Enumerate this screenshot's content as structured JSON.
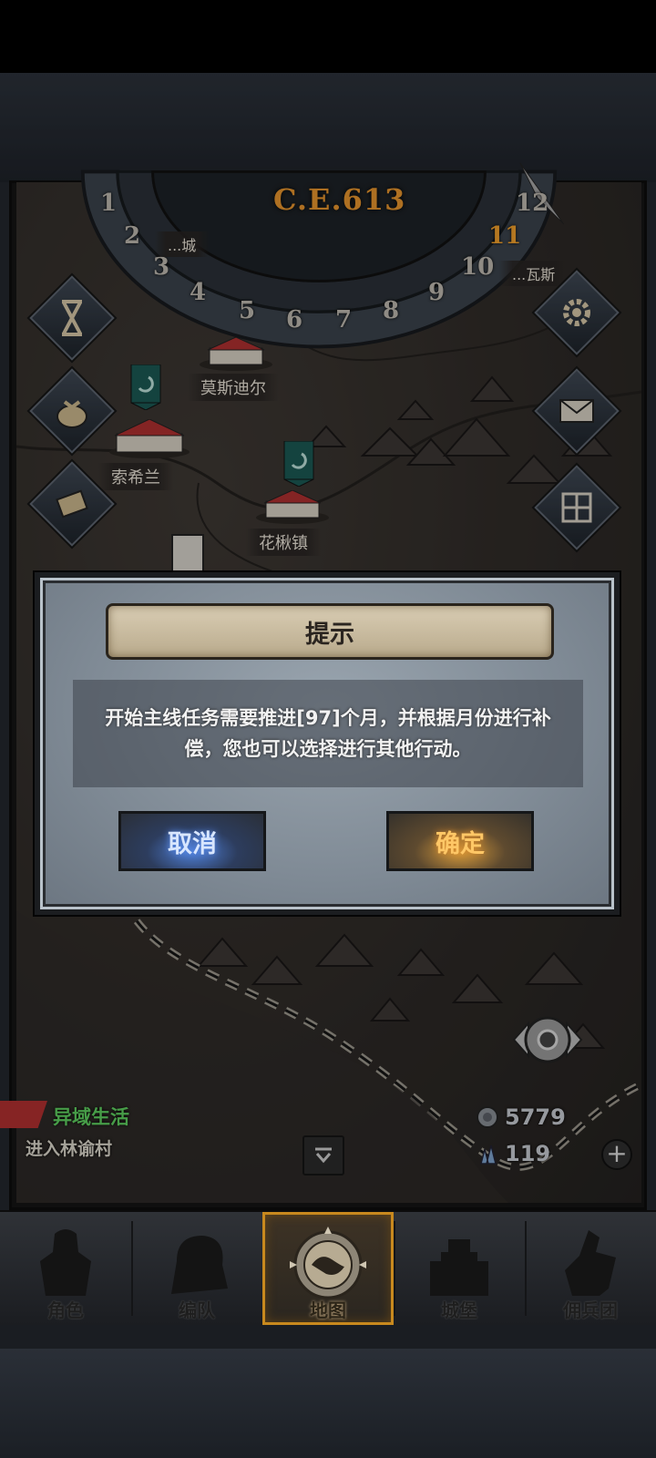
{
  "calendar": {
    "year": "C.E.613",
    "months": [
      "1",
      "2",
      "3",
      "4",
      "5",
      "6",
      "7",
      "8",
      "9",
      "10",
      "11",
      "12"
    ],
    "current_month": "11"
  },
  "map": {
    "towns": [
      {
        "label": "莫斯迪尔"
      },
      {
        "label": "索希兰"
      },
      {
        "label": "花楸镇"
      }
    ],
    "partial_labels": [
      "...城",
      "...瓦斯"
    ]
  },
  "side_buttons": [
    {
      "icon": "hourglass-icon"
    },
    {
      "icon": "money-bag-icon"
    },
    {
      "icon": "scroll-icon"
    },
    {
      "icon": "gear-icon"
    },
    {
      "icon": "mail-icon"
    },
    {
      "icon": "window-icon"
    }
  ],
  "quest": {
    "title": "异域生活",
    "subtitle": "进入林谕村"
  },
  "resources": {
    "silver": "5779",
    "crystal": "119"
  },
  "dialog": {
    "title": "提示",
    "message": "开始主线任务需要推进[97]个月，并根据月份进行补偿，您也可以选择进行其他行动。",
    "cancel_label": "取消",
    "ok_label": "确定"
  },
  "nav": {
    "items": [
      {
        "label": "角色",
        "icon": "knight-icon"
      },
      {
        "label": "编队",
        "icon": "helmet-icon"
      },
      {
        "label": "地图",
        "icon": "compass-map-icon"
      },
      {
        "label": "城堡",
        "icon": "castle-icon"
      },
      {
        "label": "佣兵团",
        "icon": "mercenary-icon"
      }
    ],
    "active": "地图"
  },
  "colors": {
    "accent_gold": "#e8962e",
    "quest_green": "#5fd160",
    "cancel_blue": "#4f7fd6",
    "ok_orange": "#d69a3c"
  }
}
